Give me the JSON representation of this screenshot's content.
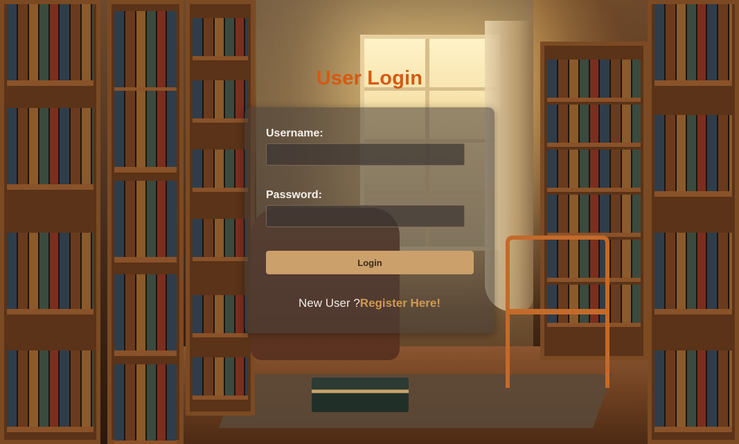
{
  "page": {
    "title": "User Login"
  },
  "form": {
    "username_label": "Username:",
    "username_value": "",
    "password_label": "Password:",
    "password_value": "",
    "login_button_label": "Login"
  },
  "register": {
    "prompt": "New User ?",
    "link_label": "Register Here!"
  },
  "colors": {
    "title": "#d45a12",
    "button": "#cba06a",
    "link": "#cf9a55",
    "card": "rgba(70,62,58,0.55)"
  }
}
